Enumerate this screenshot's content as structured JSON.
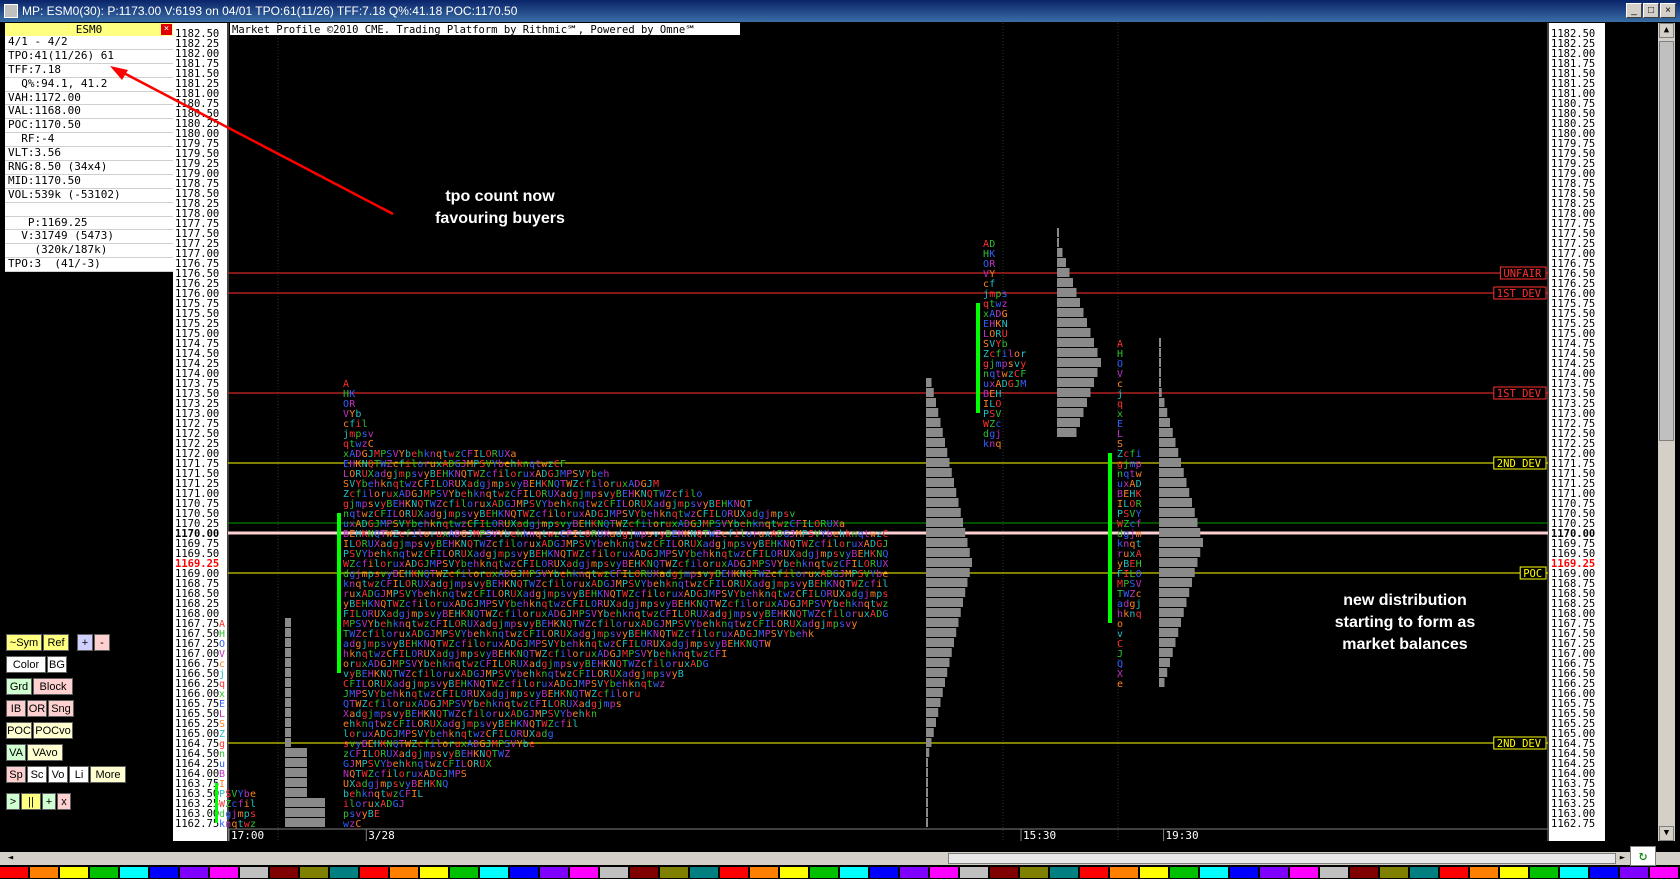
{
  "window": {
    "title": "MP: ESM0(30): P:1173.00 V:6193 on 04/01 TPO:61(11/26) TFF:7.18 Q%:41.18 POC:1170.50",
    "buttons": [
      "_",
      "□",
      "×"
    ]
  },
  "symbol_panel": {
    "symbol": "ESM0",
    "close_label": "×",
    "info": [
      "4/1 - 4/2",
      "TPO:41(11/26) 61",
      "TFF:7.18",
      "  Q%:94.1, 41.2",
      "VAH:1172.00",
      "VAL:1168.00",
      "POC:1170.50",
      "  RF:-4",
      "VLT:3.56",
      "RNG:8.50 (34x4)",
      "MID:1170.50",
      "VOL:539k (-53102)",
      "",
      "   P:1169.25",
      "  V:31749 (5473)",
      "    (320k/187k)",
      "TPO:3  (41/-3)"
    ]
  },
  "toolbar": {
    "rows": [
      [
        {
          "label": "~Sym",
          "bg": "#ffff80"
        },
        {
          "label": "Ref",
          "bg": "#ffff80"
        },
        {
          "label": "+",
          "bg": "#d0d0ff"
        },
        {
          "label": "-",
          "bg": "#ffd0d0"
        }
      ],
      [
        {
          "label": "Color",
          "bg": "#ffffff"
        },
        {
          "label": "BG",
          "bg": "#ffffff"
        }
      ],
      [
        {
          "label": "Grd",
          "bg": "#d0ffd0"
        },
        {
          "label": "Block",
          "bg": "#ffd0d0"
        }
      ],
      [
        {
          "label": "IB",
          "bg": "#ffd0d0"
        },
        {
          "label": "OR",
          "bg": "#ffd0d0"
        },
        {
          "label": "Sng",
          "bg": "#ffd0d0"
        }
      ],
      [
        {
          "label": "POC",
          "bg": "#ffffd0"
        },
        {
          "label": "POCvo",
          "bg": "#ffffd0"
        }
      ],
      [
        {
          "label": "VA",
          "bg": "#d0ffd0"
        },
        {
          "label": "VAvo",
          "bg": "#ffffd0"
        }
      ],
      [
        {
          "label": "Sp",
          "bg": "#ffd0d0"
        },
        {
          "label": "Sc",
          "bg": "#ffffff"
        },
        {
          "label": "Vo",
          "bg": "#ffffff"
        },
        {
          "label": "Li",
          "bg": "#ffffff"
        },
        {
          "label": "More",
          "bg": "#ffffd0"
        }
      ],
      [
        {
          "label": ">",
          "bg": "#d0ffd0"
        },
        {
          "label": "||",
          "bg": "#ffff80"
        },
        {
          "label": "+",
          "bg": "#d0ffd0"
        },
        {
          "label": "x",
          "bg": "#ffd0d0"
        }
      ]
    ]
  },
  "chart": {
    "copyright": "Market Profile ©2010 CME. Trading Platform by Rithmic℠, Powered by Omne℠",
    "price_scale": {
      "max": 1182.5,
      "min": 1162.75,
      "step": 0.25
    },
    "current_price": "1169.25",
    "highlight_price": "1170.00",
    "time_labels": [
      {
        "label": "17:00",
        "frac": 0.0
      },
      {
        "label": "3/28",
        "frac": 0.104
      },
      {
        "label": "15:30",
        "frac": 0.6
      },
      {
        "label": "19:30",
        "frac": 0.708
      }
    ],
    "levels": [
      {
        "label": "UNFAIR",
        "price": 1176.5,
        "color": "#ff3030"
      },
      {
        "label": "1ST DEV",
        "price": 1176.0,
        "color": "#ff3030"
      },
      {
        "label": "1ST DEV",
        "price": 1173.5,
        "color": "#ff3030"
      },
      {
        "label": "2ND DEV",
        "price": 1171.75,
        "color": "#ffff00"
      },
      {
        "label": "POC",
        "price": 1169.0,
        "color": "#ffff00"
      },
      {
        "label": "2ND DEV",
        "price": 1164.75,
        "color": "#ffff00"
      }
    ]
  },
  "annotations": {
    "tpo_note": "tpo count now\nfavouring buyers",
    "distribution_note": "new distribution\nstarting to form as\nmarket balances"
  },
  "colors": {
    "accent_green": "#00ff00",
    "volume_gray": "#808080",
    "arrow_red": "#ff0000"
  }
}
